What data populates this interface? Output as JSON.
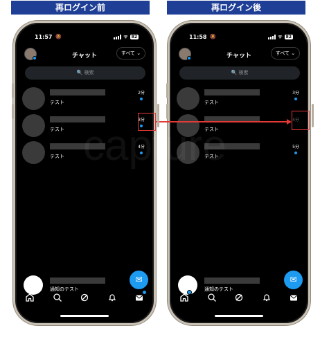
{
  "banners": {
    "left": "再ログイン前",
    "right": "再ログイン後"
  },
  "colors": {
    "banner": "#1f3f96",
    "accent": "#1d9bf0",
    "highlight": "#e53935"
  },
  "watermark": "capture",
  "phones": [
    {
      "status": {
        "time": "11:57",
        "battery": "82"
      },
      "header": {
        "title": "チャット",
        "filter": "すべて ⌄"
      },
      "search": {
        "placeholder": "🔍 検索"
      },
      "rows": [
        {
          "message": "テスト",
          "time": "2分"
        },
        {
          "message": "テスト",
          "time": "3分"
        },
        {
          "message": "テスト",
          "time": "4分"
        }
      ],
      "notification": {
        "message": "通知のテスト"
      }
    },
    {
      "status": {
        "time": "11:58",
        "battery": "82"
      },
      "header": {
        "title": "チャット",
        "filter": "すべて ⌄"
      },
      "search": {
        "placeholder": "🔍 検索"
      },
      "rows": [
        {
          "message": "テスト",
          "time": "3分"
        },
        {
          "message": "テスト",
          "time": "4分"
        },
        {
          "message": "テスト",
          "time": "5分"
        }
      ],
      "notification": {
        "message": "通知のテスト"
      }
    }
  ],
  "icons": [
    "home-icon",
    "search-icon",
    "spaces-icon",
    "bell-icon",
    "mail-icon",
    "compose-icon"
  ]
}
